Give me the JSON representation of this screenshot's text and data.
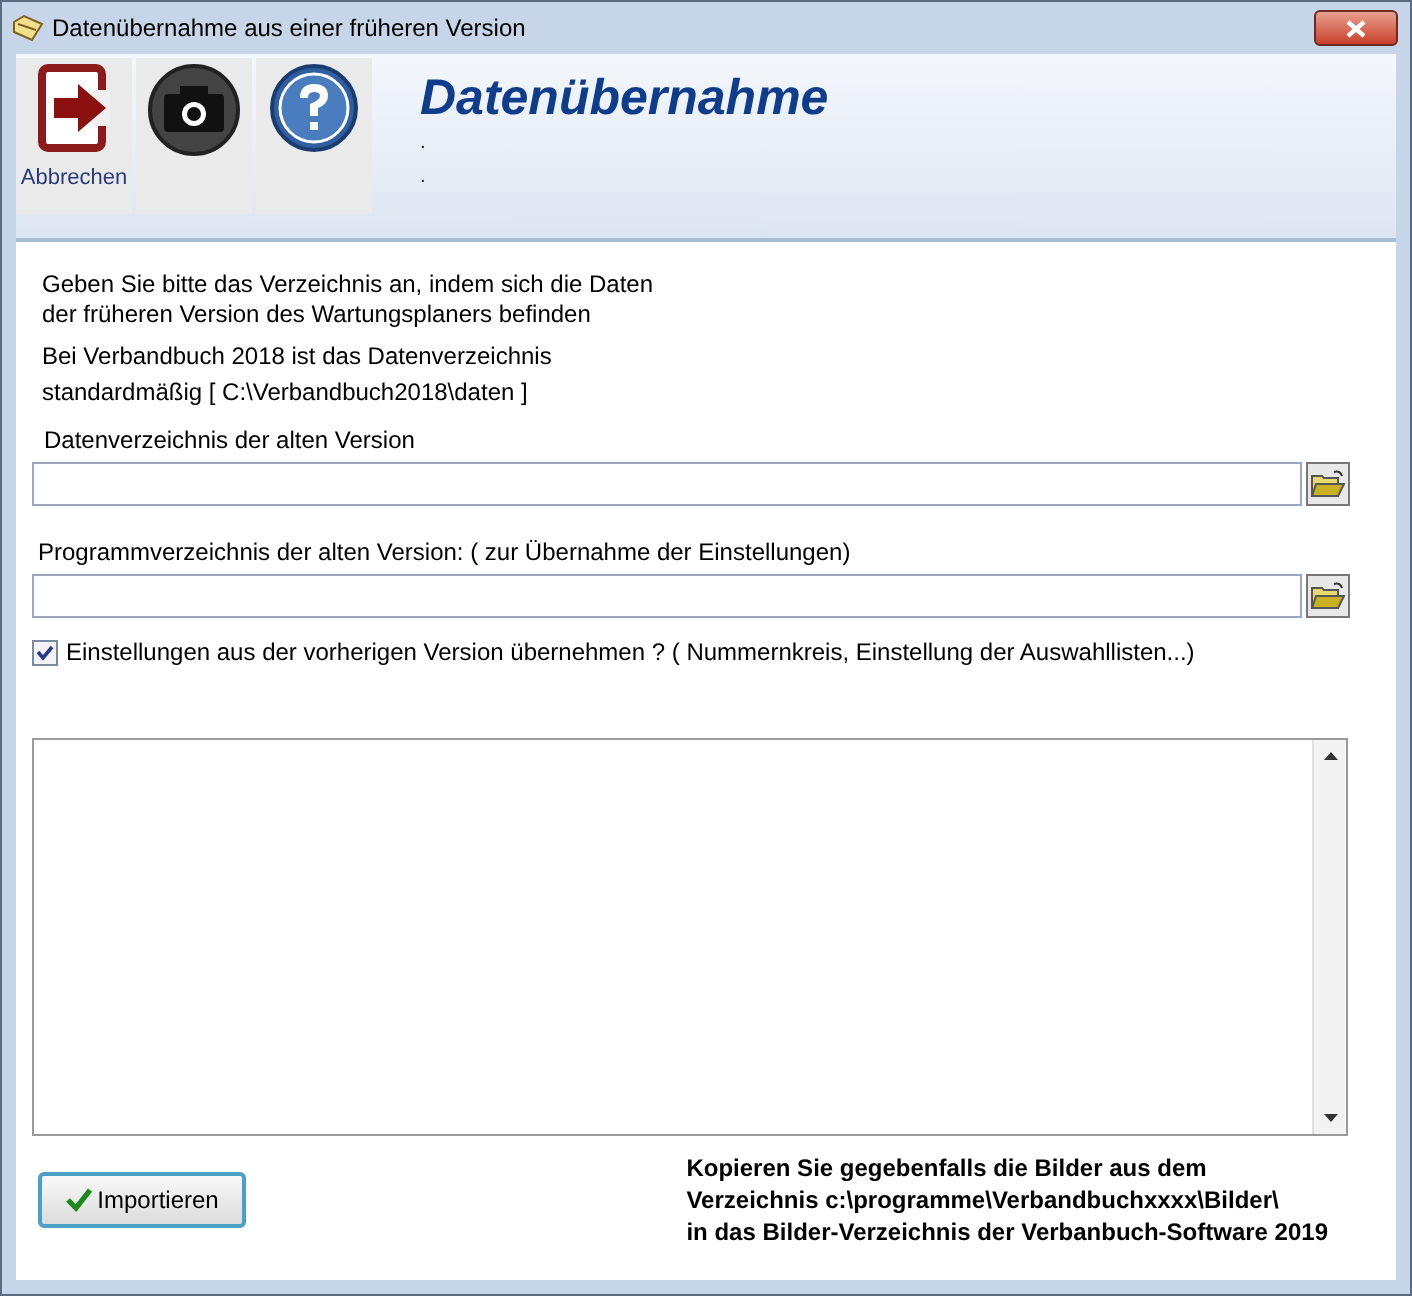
{
  "window": {
    "title": "Datenübernahme aus einer früheren Version"
  },
  "toolbar": [
    {
      "kind": "exit",
      "label": "Abbrechen"
    },
    {
      "kind": "camera"
    },
    {
      "kind": "help"
    }
  ],
  "header": {
    "title": "Datenübernahme",
    "lines": [
      ".",
      "."
    ]
  },
  "intro": [
    "Geben Sie bitte das Verzeichnis an, indem sich die Daten",
    "der früheren Version des Wartungsplaners befinden"
  ],
  "info": [
    "Bei Verbandbuch 2018 ist das Datenverzeichnis",
    "standardmäßig  [ C:\\Verbandbuch2018\\daten ]"
  ],
  "fields": [
    {
      "label": "Datenverzeichnis der alten Version"
    },
    {
      "label": "Programmverzeichnis der alten Version: ( zur Übernahme der Einstellungen)"
    }
  ],
  "option": {
    "label": "Einstellungen aus der vorherigen Version übernehmen ? ( Nummernkreis, Einstellung der Auswahllisten...)",
    "checked": true
  },
  "import_button": {
    "label": "Importieren"
  },
  "note": [
    "Kopieren Sie gegebenfalls die Bilder aus dem",
    "Verzeichnis c:\\programme\\Verbandbuchxxxx\\Bilder\\",
    "in das Bilder-Verzeichnis der Verbanbuch-Software 2019"
  ]
}
